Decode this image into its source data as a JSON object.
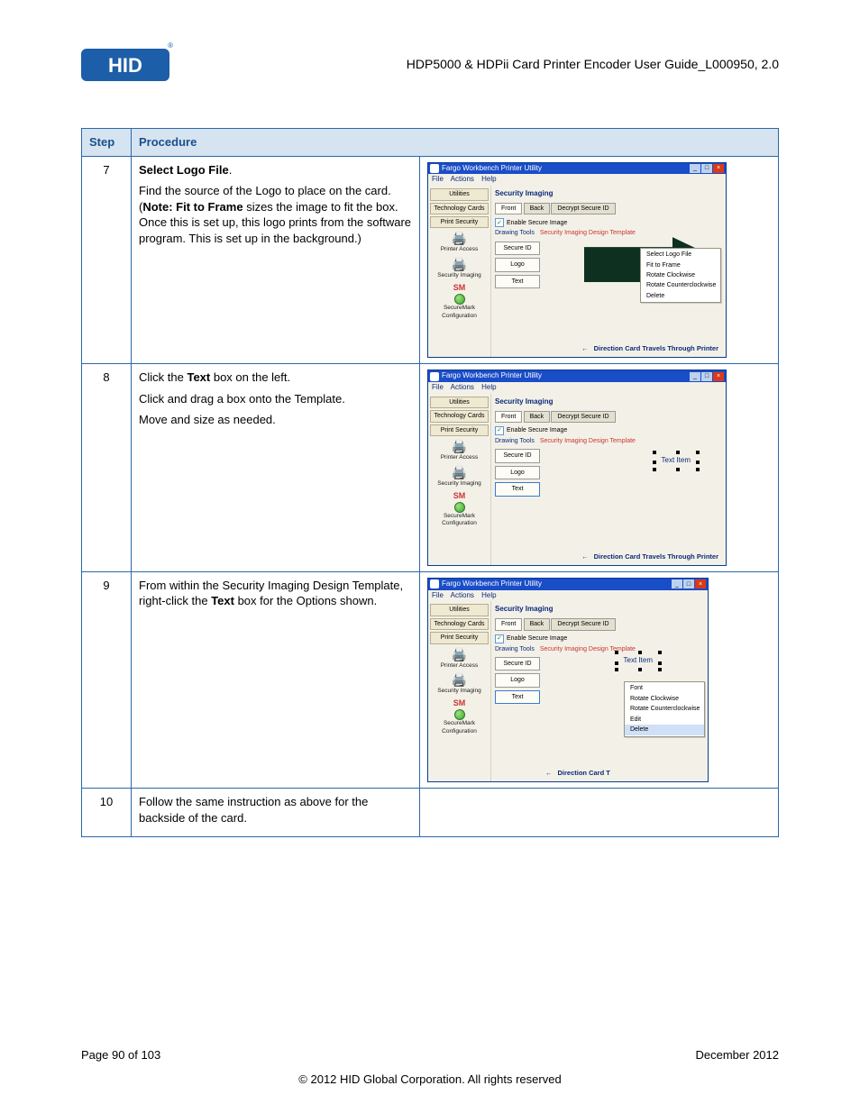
{
  "header": {
    "doc_title": "HDP5000 & HDPii Card Printer Encoder User Guide_L000950, 2.0"
  },
  "table": {
    "col_step": "Step",
    "col_proc": "Procedure",
    "rows": [
      {
        "num": "7",
        "proc_html": {
          "line1_bold": "Select Logo File",
          "line1_rest": ".",
          "line2a": "Find the source of the Logo to place on the card. (",
          "line2_bold": "Note: Fit to Frame",
          "line2b": " sizes the image to fit the box. Once this is set up, this logo prints from the software program. This is set up in the background.)"
        }
      },
      {
        "num": "8",
        "proc_html": {
          "l1a": "Click the ",
          "l1_bold": "Text",
          "l1b": " box on the left.",
          "l2": "Click and drag a box onto the Template.",
          "l3": "Move and size as needed."
        }
      },
      {
        "num": "9",
        "proc_html": {
          "l1a": "From within the Security Imaging Design Template, right-click the ",
          "l1_bold": "Text",
          "l1b": " box for the Options shown."
        }
      },
      {
        "num": "10",
        "proc_text": "Follow the same instruction as above for the backside of the card."
      }
    ]
  },
  "miniwin": {
    "title": "Fargo Workbench Printer Utility",
    "menu": {
      "file": "File",
      "actions": "Actions",
      "help": "Help"
    },
    "side": {
      "utilities": "Utilities",
      "tech_cards": "Technology Cards",
      "print_security": "Print Security",
      "printer_access": "Printer Access",
      "security_imaging": "Security Imaging",
      "sm": "SM",
      "securemark_cfg": "SecureMark Configuration"
    },
    "main": {
      "heading": "Security Imaging",
      "tab_front": "Front",
      "tab_back": "Back",
      "tab_decrypt": "Decrypt Secure ID",
      "enable": "Enable Secure Image",
      "drawing_tools": "Drawing Tools",
      "design_template": "Security Imaging Design Template",
      "btn_secure_id": "Secure ID",
      "btn_logo": "Logo",
      "btn_text": "Text",
      "text_item": "Text Item",
      "direction": "Direction Card Travels Through Printer",
      "direction_short": "Direction Card T"
    },
    "ctx7": {
      "i1": "Select Logo File",
      "i2": "Fit to Frame",
      "i3": "Rotate Clockwise",
      "i4": "Rotate Counterclockwise",
      "i5": "Delete"
    },
    "ctx9": {
      "i1": "Font",
      "i2": "Rotate Clockwise",
      "i3": "Rotate Counterclockwise",
      "i4": "Edit",
      "i5": "Delete"
    }
  },
  "footer": {
    "page": "Page 90 of 103",
    "date": "December 2012",
    "copyright": "© 2012 HID Global Corporation. All rights reserved"
  }
}
